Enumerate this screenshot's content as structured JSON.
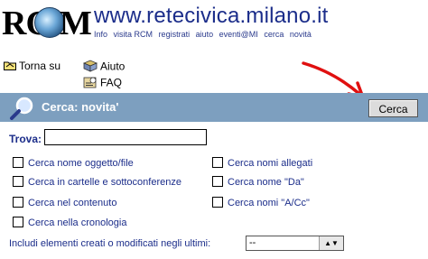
{
  "header": {
    "logo_text": "RCM",
    "site_title": "www.retecivica.milano.it",
    "nav": [
      "Info",
      "visita RCM",
      "registrati",
      "aiuto",
      "eventi@MI",
      "cerca",
      "novità"
    ]
  },
  "toolbar": {
    "up_label": "Torna su",
    "help_label": "Aiuto",
    "faq_label": "FAQ"
  },
  "titlebar": {
    "title": "Cerca: novita'",
    "search_button": "Cerca",
    "color": "#7d9fbf"
  },
  "form": {
    "trova_label": "Trova:",
    "trova_value": "",
    "options": {
      "nome_oggetto": "Cerca nome oggetto/file",
      "cartelle": "Cerca in cartelle e sottoconferenze",
      "contenuto": "Cerca nel contenuto",
      "cronologia": "Cerca nella cronologia",
      "allegati": "Cerca nomi allegati",
      "da": "Cerca nome \"Da\"",
      "a_cc": "Cerca nomi \"A/Cc\""
    },
    "include_label": "Includi elementi creati o modificati negli ultimi:",
    "include_value": "--"
  },
  "colors": {
    "link": "#1b2d8a",
    "arrow": "#e01010"
  }
}
